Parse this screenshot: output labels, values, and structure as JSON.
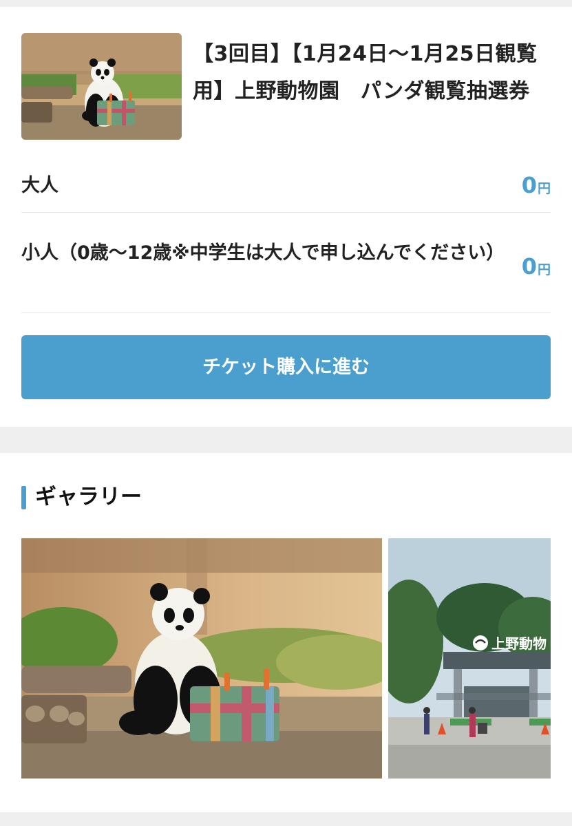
{
  "ticket": {
    "title": "【3回目】【1月24日〜1月25日観覧用】上野動物園　パンダ観覧抽選券",
    "thumbnail_alt": "panda-photo",
    "prices": [
      {
        "label": "大人",
        "amount": "0",
        "unit": "円"
      },
      {
        "label": "小人（0歳〜12歳※中学生は大人で申し込んでください）",
        "amount": "0",
        "unit": "円"
      }
    ],
    "cta_label": "チケット購入に進む"
  },
  "gallery": {
    "title": "ギャラリー",
    "zoo_sign_text": "上野動物"
  },
  "colors": {
    "accent": "#4a9fcf",
    "page_bg": "#efefef",
    "divider": "#e6e6e6"
  }
}
